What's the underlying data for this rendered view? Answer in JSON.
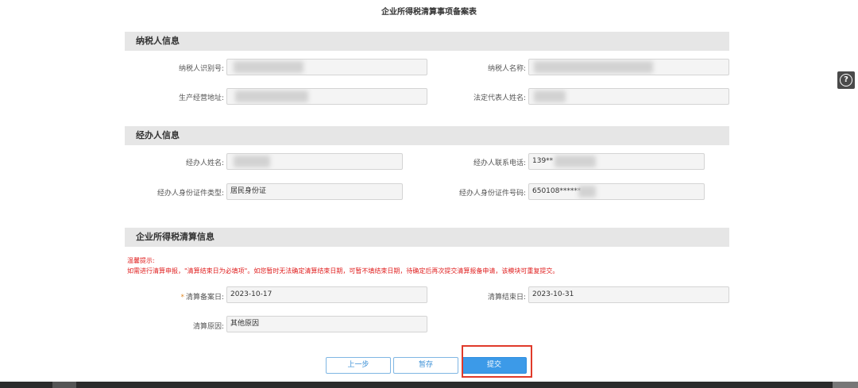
{
  "page": {
    "title": "企业所得税清算事项备案表"
  },
  "taxpayer": {
    "header": "纳税人信息",
    "id_label": "纳税人识别号:",
    "name_label": "纳税人名称:",
    "address_label": "生产经营地址:",
    "address_value": "",
    "legal_rep_label": "法定代表人姓名:"
  },
  "agent": {
    "header": "经办人信息",
    "name_label": "经办人姓名:",
    "phone_label": "经办人联系电话:",
    "phone_value": "139**",
    "id_type_label": "经办人身份证件类型:",
    "id_type_value": "居民身份证",
    "id_number_label": "经办人身份证件号码:",
    "id_number_value": "650108******"
  },
  "liquidation": {
    "header": "企业所得税清算信息",
    "tip_title": "温馨提示:",
    "tip_text": "如需进行清算申报，\"清算结束日为必填项\"。如您暂时无法确定清算结束日期，可暂不填结束日期，待确定后再次提交清算报备申请，该模块可重复提交。",
    "required_mark": "*",
    "filing_date_label": "清算备案日:",
    "filing_date_value": "2023-10-17",
    "end_date_label": "清算结束日:",
    "end_date_value": "2023-10-31",
    "reason_label": "清算原因:",
    "reason_value": "其他原因"
  },
  "actions": {
    "prev_label": "上一步",
    "save_label": "暂存",
    "submit_label": "提交"
  },
  "help": {
    "icon": "question-circle-icon",
    "glyph": "?"
  },
  "colors": {
    "section_bg": "#e6e6e6",
    "tip_red": "#e02020",
    "primary_blue": "#3c9ae8",
    "highlight_red": "#e03a2a"
  }
}
